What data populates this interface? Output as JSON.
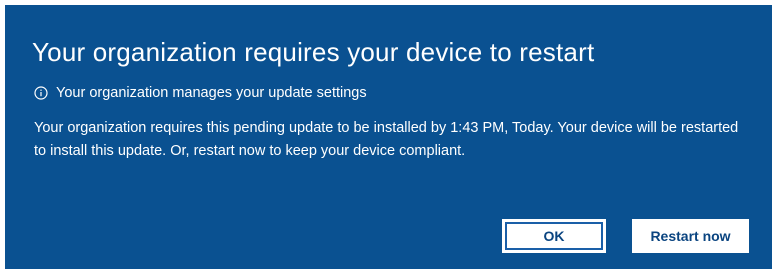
{
  "dialog": {
    "title": "Your organization requires your device to restart",
    "managed_notice": "Your organization manages your update settings",
    "message": "Your organization requires this pending update to be installed by 1:43 PM, Today. Your device will be restarted to install this update. Or, restart now to keep your device compliant.",
    "ok_label": "OK",
    "restart_label": "Restart now",
    "info_icon": "info-icon",
    "colors": {
      "background": "#0a5191",
      "text": "#ffffff",
      "button_background": "#ffffff",
      "button_text": "#0a4480"
    }
  }
}
